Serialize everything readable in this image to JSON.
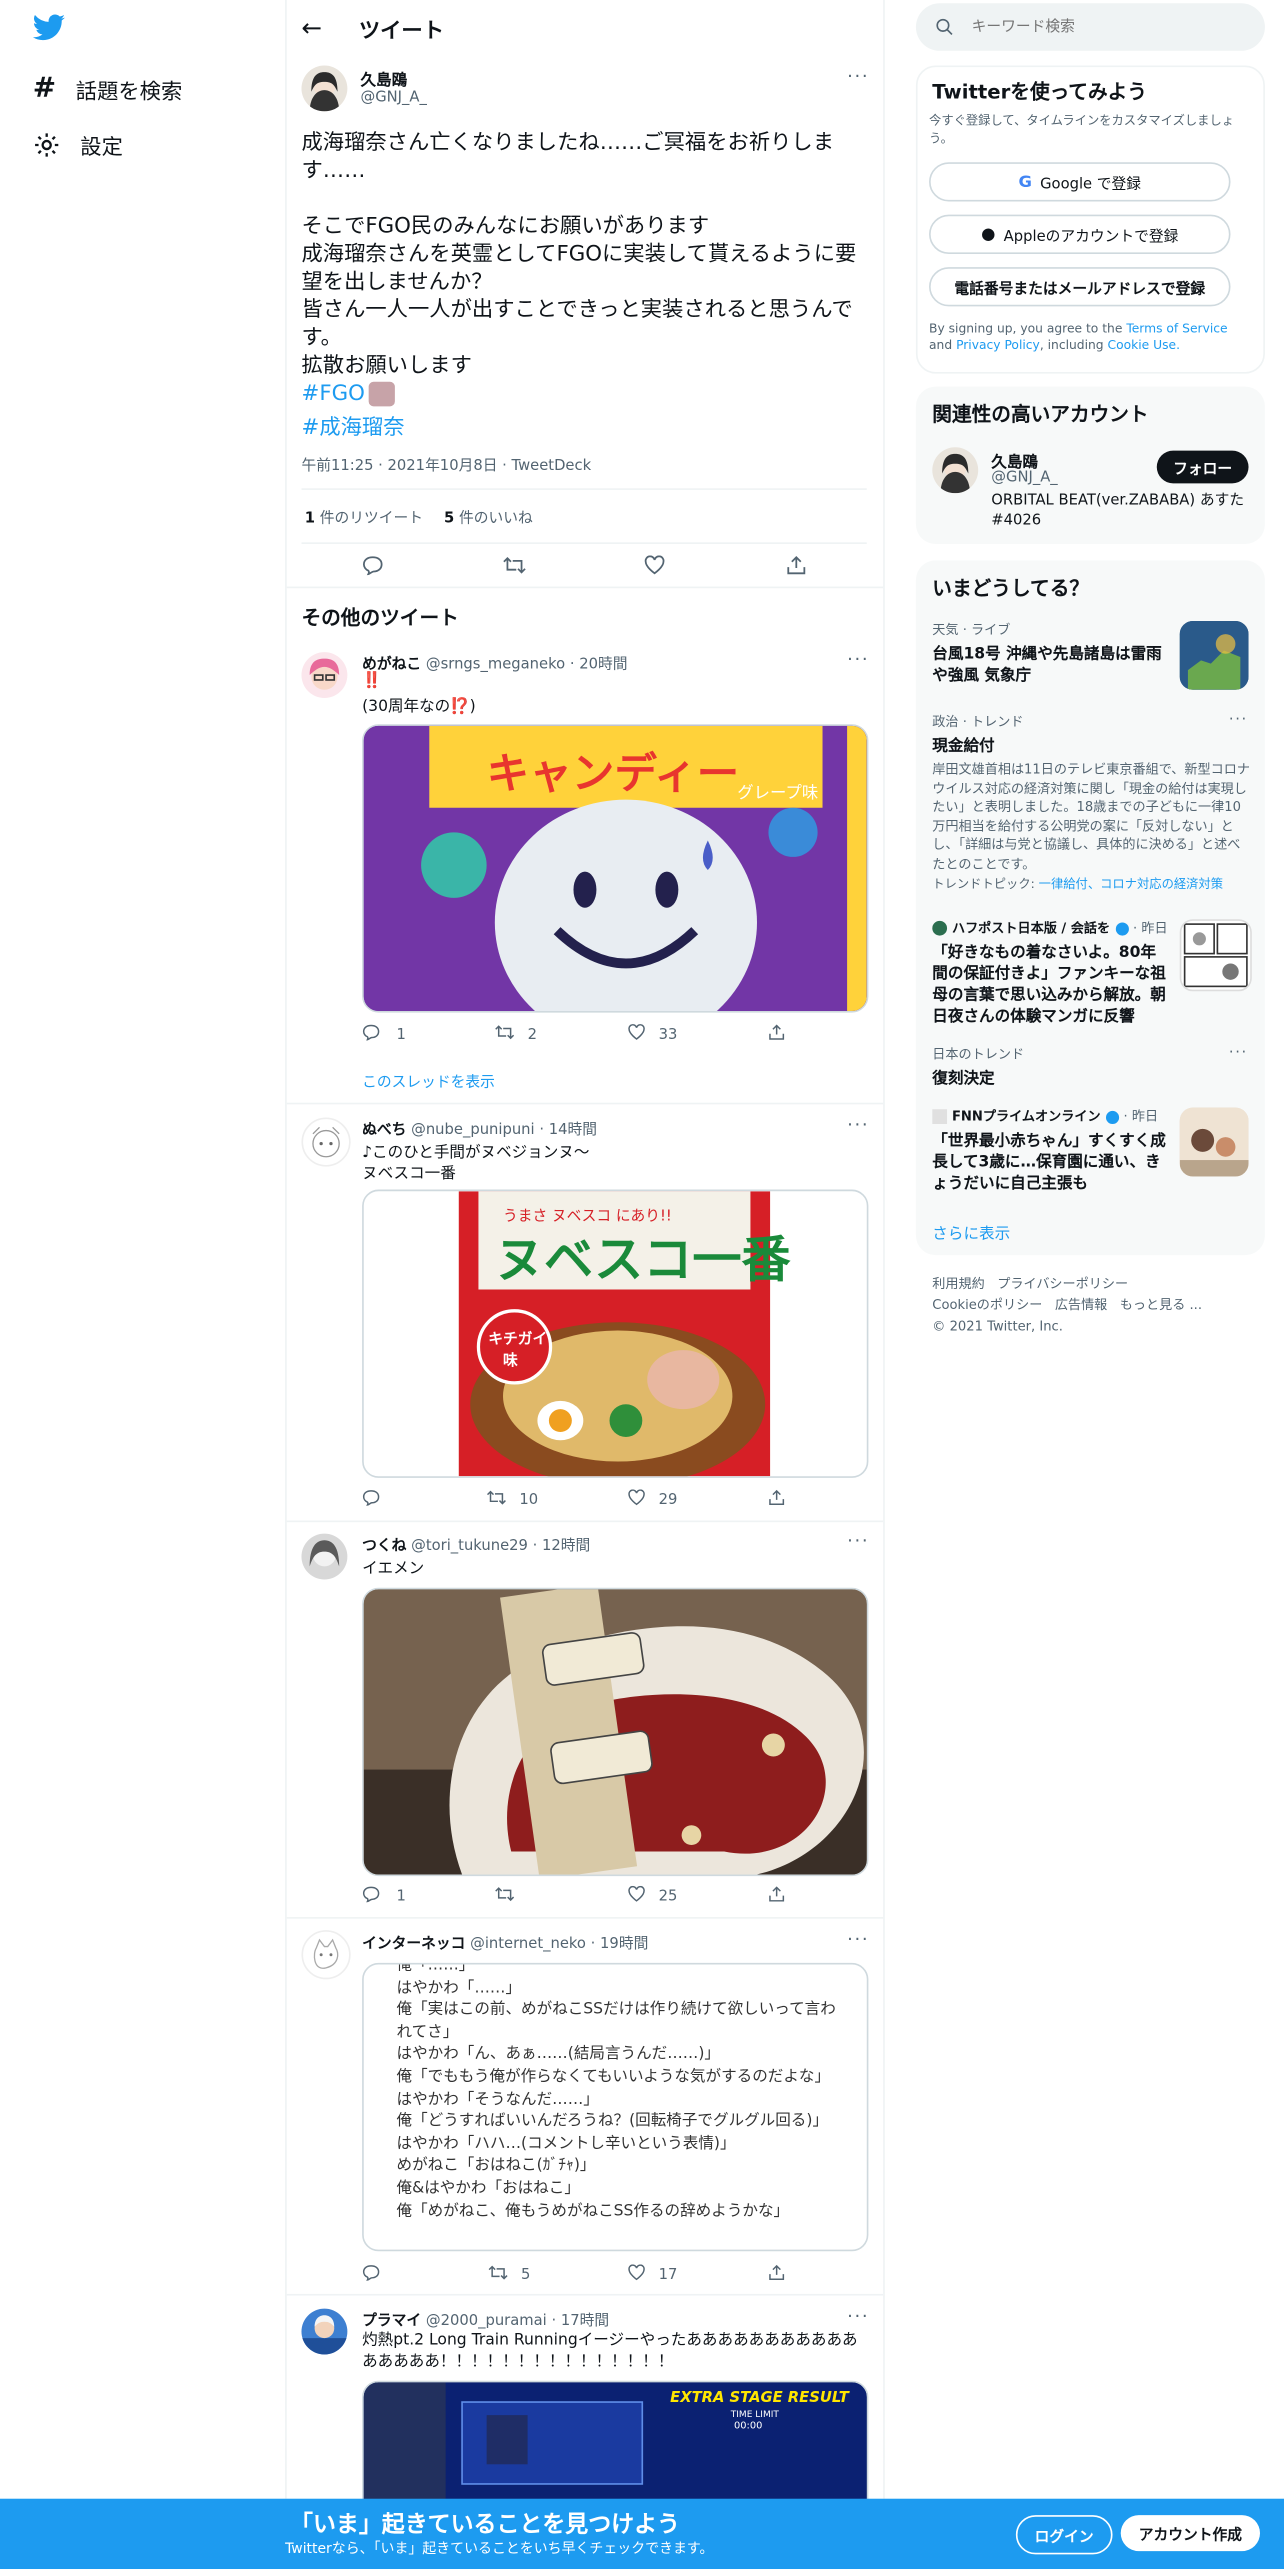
{
  "nav": {
    "explore": "話題を検索",
    "settings": "設定"
  },
  "header": {
    "title": "ツイート"
  },
  "search": {
    "placeholder": "キーワード検索"
  },
  "main_tweet": {
    "name": "久島鴎",
    "handle": "@GNJ_A_",
    "text": "成海瑠奈さん亡くなりましたね……ご冥福をお祈りします……\n\nそこでFGO民のみんなにお願いがあります\n成海瑠奈さんを英霊としてFGOに実装して貰えるように要望を出しませんか？\n皆さん一人一人が出すことできっと実装されると思うんです。\n拡散お願いします",
    "hashtag1": "#FGO",
    "hashtag2": "#成海瑠奈",
    "meta": "午前11:25 · 2021年10月8日 · TweetDeck",
    "retweets_count": "1",
    "retweets_label": " 件のリツイート",
    "likes_count": "5",
    "likes_label": " 件のいいね"
  },
  "other_heading": "その他のツイート",
  "tweets": [
    {
      "name": "めがねこ",
      "handle": "@srngs_meganeko",
      "time": "· 20時間",
      "line1": "‼️",
      "line2": "(30周年なの⁉️)",
      "replies": "1",
      "retweets": "2",
      "likes": "33",
      "thread_link": "このスレッドを表示"
    },
    {
      "name": "ぬべち",
      "handle": "@nube_punipuni",
      "time": "· 14時間",
      "line1": "♪このひと手間がヌベジョンヌ〜",
      "line2": "ヌベスコ一番",
      "replies": "",
      "retweets": "10",
      "likes": "29"
    },
    {
      "name": "つくね",
      "handle": "@tori_tukune29",
      "time": "· 12時間",
      "line1": "イエメン",
      "replies": "1",
      "retweets": "",
      "likes": "25"
    },
    {
      "name": "インターネッコ",
      "handle": "@internet_neko",
      "time": "· 19時間",
      "card_text": "俺「……」\nはやかわ「……」\n俺「実はこの前、めがねこSSだけは作り続けて欲しいって言われてさ」\nはやかわ「ん、あぁ……(結局言うんだ……)」\n俺「でももう俺が作らなくてもいいような気がするのだよな」\nはやかわ「そうなんだ……」\n俺「どうすればいいんだろうね？(回転椅子でグルグル回る)」\nはやかわ「ハハ…(コメントし辛いという表情)」\nめがねこ「おはねこ(ｶﾞﾁｬ)」\n俺&はやかわ「おはねこ」\n俺「めがねこ、俺もうめがねこSS作るの辞めようかな」",
      "replies": "",
      "retweets": "5",
      "likes": "17"
    },
    {
      "name": "プラマイ",
      "handle": "@2000_puramai",
      "time": "· 17時間",
      "line1": "灼熱pt.2 Long Train Runningイージーやったああああああああああああああああ！！！！！！！！！！！！！！！",
      "card_top": "EXTRA STAGE RESULT",
      "card_sub": "TIME LIMIT",
      "card_time": "00:00"
    }
  ],
  "signup": {
    "title": "Twitterを使ってみよう",
    "subtitle": "今すぐ登録して、タイムラインをカスタマイズしましょう。",
    "google": "Google で登録",
    "apple": "Appleのアカウントで登録",
    "phone": "電話番号またはメールアドレスで登録",
    "terms_prefix": "By signing up, you agree to the ",
    "terms_link": "Terms of Service",
    "terms_and": " and ",
    "privacy_link": "Privacy Policy",
    "terms_incl": ", including ",
    "cookie_link": "Cookie Use."
  },
  "related": {
    "title": "関連性の高いアカウント",
    "name": "久島鴎",
    "handle": "@GNJ_A_",
    "follow": "フォロー",
    "bio": "ORBITAL BEAT(ver.ZABABA) あすた#4026"
  },
  "trends": {
    "title": "いまどうしてる？",
    "t1_meta": "天気 · ライブ",
    "t1_title": "台風18号 沖縄や先島諸島は雷雨や強風 気象庁",
    "t2_meta": "政治 · トレンド",
    "t2_title": "現金給付",
    "t2_desc": "岸田文雄首相は11日のテレビ東京番組で、新型コロナウイルス対応の経済対策に関し「現金の給付は実現したい」と表明しました。18歳までの子どもに一律10万円相当を給付する公明党の案に「反対しない」とし、「詳細は与党と協議し、具体的に決める」と述べたとのことです。",
    "t2_topics_label": "トレンドトピック: ",
    "t2_topics": "一律給付、コロナ対応の経済対策",
    "t3_source": "ハフポスト日本版 / 会話を",
    "t3_time": "· 昨日",
    "t3_title": "「好きなもの着なさいよ。80年間の保証付きよ」ファンキーな祖母の言葉で思い込みから解放。朝日夜さんの体験マンガに反響",
    "t4_meta": "日本のトレンド",
    "t4_title": "復刻決定",
    "t5_source": "FNNプライムオンライン",
    "t5_time": "· 昨日",
    "t5_title": "「世界最小赤ちゃん」すくすく成長して3歳に…保育園に通い、きょうだいに自己主張も",
    "more": "さらに表示"
  },
  "footer": {
    "terms": "利用規約",
    "privacy": "プライバシーポリシー",
    "cookie": "Cookieのポリシー",
    "ads": "広告情報",
    "more": "もっと見る ...",
    "copy": "© 2021 Twitter, Inc."
  },
  "bottom": {
    "title": "「いま」起きていることを見つけよう",
    "subtitle": "Twitterなら、「いま」起きていることをいち早くチェックできます。",
    "login": "ログイン",
    "signup": "アカウント作成"
  },
  "colors": {
    "brand": "#1d9bf0",
    "banner": "#1d9bf0"
  }
}
